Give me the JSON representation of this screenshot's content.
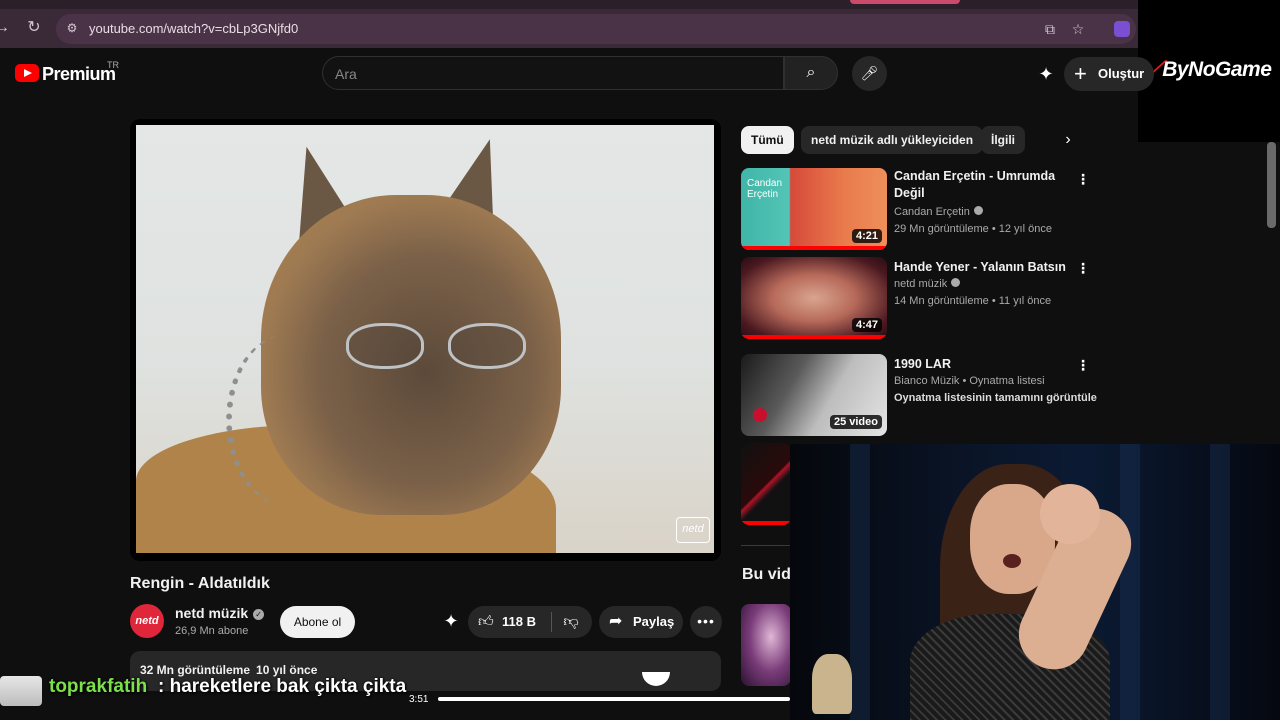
{
  "browser": {
    "url": "youtube.com/watch?v=cbLp3GNjfd0"
  },
  "overlay_brand": {
    "logo_text": "ByNoGame"
  },
  "header": {
    "logo_label": "Premium",
    "logo_region": "TR",
    "search_placeholder": "Ara",
    "create_label": "Oluştur"
  },
  "video": {
    "title": "Rengin - Aldatıldık",
    "watermark": "netd",
    "channel": {
      "name": "netd müzik",
      "avatar_text": "netd",
      "subscribers": "26,9 Mn abone"
    },
    "subscribe_label": "Abone ol",
    "likes": "118 B",
    "share_label": "Paylaş",
    "views": "32 Mn görüntüleme",
    "age": "10 yıl önce"
  },
  "sidebar": {
    "chips": [
      {
        "label": "Tümü",
        "active": true
      },
      {
        "label": "netd müzik adlı yükleyiciden",
        "active": false
      },
      {
        "label": "İlgili",
        "active": false
      }
    ],
    "recommendations": [
      {
        "title": "Candan Erçetin - Umrumda Değil",
        "channel": "Candan Erçetin",
        "meta": "29 Mn görüntüleme • 12 yıl önce",
        "duration": "4:21",
        "thumb_text": "Candan Erçetin"
      },
      {
        "title": "Hande Yener - Yalanın Batsın",
        "channel": "netd müzik",
        "meta": "14 Mn görüntüleme • 11 yıl önce",
        "duration": "4:47"
      },
      {
        "title": "1990 LAR",
        "channel": "Bianco Müzik • Oynatma listesi",
        "meta": "Oynatma listesinin tamamını görüntüle",
        "duration": "25 video"
      }
    ],
    "section_title": "Bu vid"
  },
  "stream_overlay": {
    "chat_user": "toprakfatih",
    "chat_message": ": hareketlere bak çikta çikta",
    "playback_time": "3:51"
  },
  "colors": {
    "youtube_red": "#ff0000",
    "chat_user_green": "#7be04a",
    "browser_chrome": "#3a2a38"
  }
}
